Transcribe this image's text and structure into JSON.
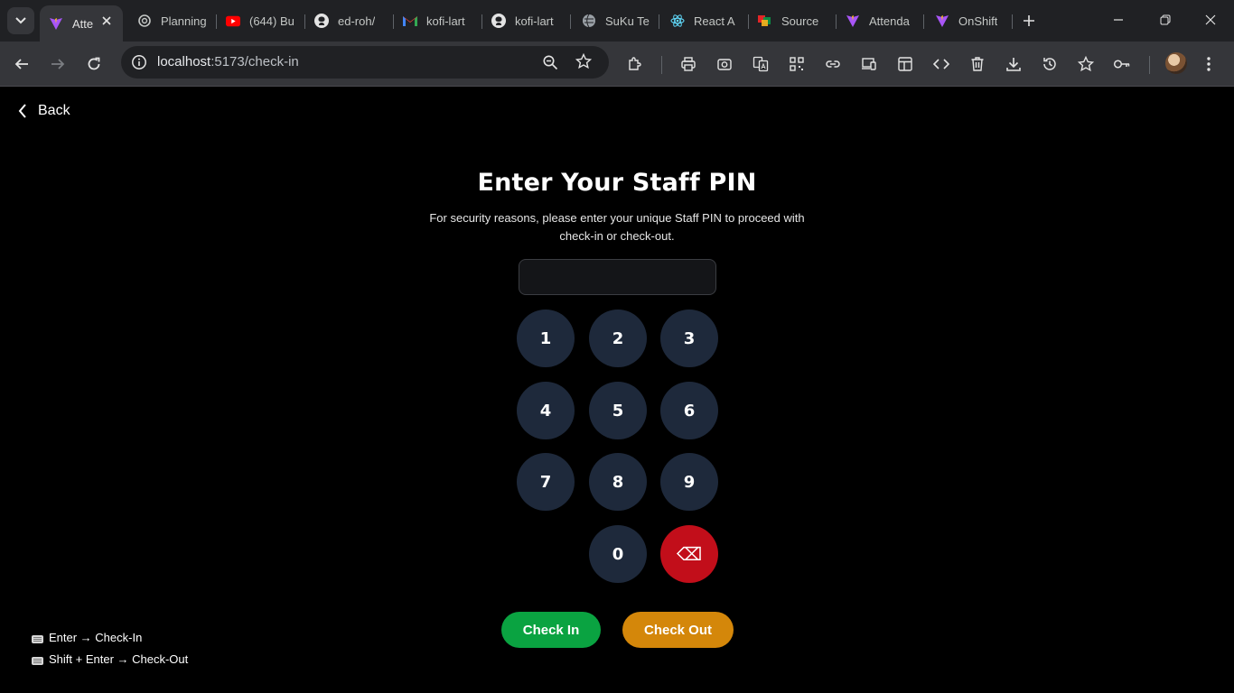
{
  "browser": {
    "tabs": [
      {
        "title": "Atte",
        "active": true,
        "icon": "vite-icon"
      },
      {
        "title": "Planning",
        "icon": "openai-icon"
      },
      {
        "title": "(644) Bu",
        "icon": "youtube-icon"
      },
      {
        "title": "ed-roh/",
        "icon": "github-icon"
      },
      {
        "title": "kofi-lart",
        "icon": "gmail-icon"
      },
      {
        "title": "kofi-lart",
        "icon": "github-icon"
      },
      {
        "title": "SuKu Te",
        "icon": "globe-icon"
      },
      {
        "title": "React A",
        "icon": "react-icon"
      },
      {
        "title": "Source",
        "icon": "zoho-icon"
      },
      {
        "title": "Attenda",
        "icon": "vite-icon"
      },
      {
        "title": "OnShift",
        "icon": "vite-icon"
      }
    ],
    "url_host": "localhost",
    "url_path": ":5173/check-in"
  },
  "page": {
    "back_label": "Back",
    "title": "Enter Your Staff PIN",
    "subtitle": "For security reasons, please enter your unique Staff PIN to proceed with check-in or check-out.",
    "pin_value": "",
    "keys": [
      "1",
      "2",
      "3",
      "4",
      "5",
      "6",
      "7",
      "8",
      "9",
      "0"
    ],
    "delete_glyph": "⌫",
    "check_in_label": "Check In",
    "check_out_label": "Check Out",
    "hints": [
      "Enter → Check-In",
      "Shift + Enter → Check-Out"
    ]
  },
  "colors": {
    "key_bg": "#1e293b",
    "delete_bg": "#c20e1a",
    "check_in_bg": "#0aa341",
    "check_out_bg": "#d4870a"
  }
}
